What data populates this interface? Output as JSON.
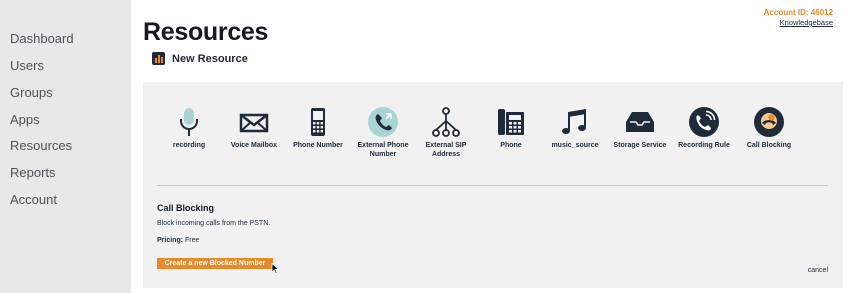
{
  "sidebar": {
    "items": [
      {
        "label": "Dashboard"
      },
      {
        "label": "Users"
      },
      {
        "label": "Groups"
      },
      {
        "label": "Apps"
      },
      {
        "label": "Resources"
      },
      {
        "label": "Reports"
      },
      {
        "label": "Account"
      }
    ]
  },
  "header": {
    "title": "Resources",
    "account_id": "Account ID: 46012",
    "knowledgebase": "Knowledgebase"
  },
  "new_resource": {
    "label": "New Resource",
    "icon": "resource-bars-icon"
  },
  "resource_types": [
    {
      "label": "recording",
      "icon": "microphone-icon"
    },
    {
      "label": "Voice Mailbox",
      "icon": "envelope-icon"
    },
    {
      "label": "Phone Number",
      "icon": "mobile-phone-icon"
    },
    {
      "label": "External Phone Number",
      "icon": "external-phone-icon"
    },
    {
      "label": "External SIP Address",
      "icon": "network-tree-icon"
    },
    {
      "label": "Phone",
      "icon": "desk-phone-icon"
    },
    {
      "label": "music_source",
      "icon": "music-notes-icon"
    },
    {
      "label": "Storage Service",
      "icon": "storage-tray-icon"
    },
    {
      "label": "Recording Rule",
      "icon": "phone-ringing-icon"
    },
    {
      "label": "Call Blocking",
      "icon": "call-blocking-icon"
    }
  ],
  "detail": {
    "title": "Call Blocking",
    "description": "Block incoming calls from the PSTN.",
    "pricing_label": "Pricing:",
    "pricing_value": "Free",
    "create_button": "Create a new Blocked Number",
    "cancel": "cancel"
  },
  "colors": {
    "accent": "#e8892a",
    "icon_dark": "#1f2b3a",
    "icon_teal": "#a9d4d4",
    "sidebar_bg": "#e8e8e8",
    "panel_bg": "#f1f1f1"
  }
}
